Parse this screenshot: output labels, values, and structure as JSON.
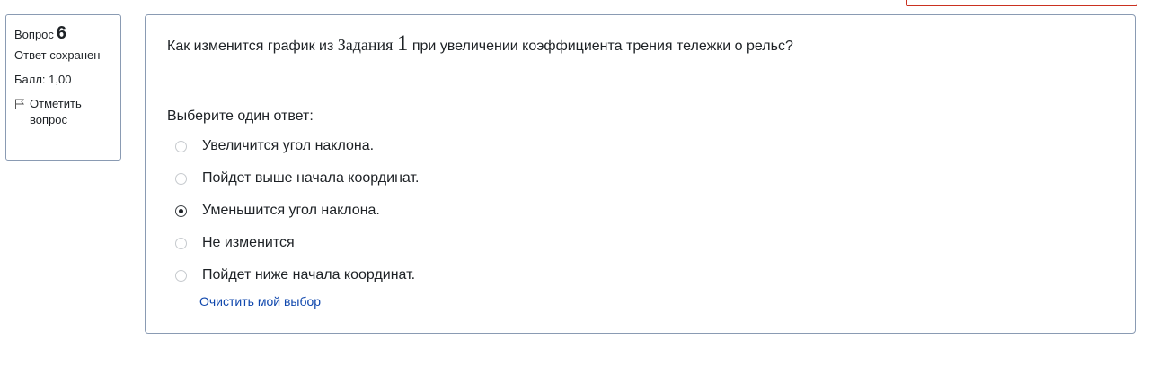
{
  "question_info": {
    "label": "Вопрос",
    "number": "6",
    "state": "Ответ сохранен",
    "grade": "Балл: 1,00",
    "flag_label": "Отметить вопрос"
  },
  "question": {
    "text_before": "Как изменится график из ",
    "text_serif": "Задания",
    "text_number": "1",
    "text_after": " при увеличении коэффициента трения тележки о рельс?",
    "prompt": "Выберите один ответ:",
    "answers": [
      {
        "label": "Увеличится угол наклона.",
        "selected": false
      },
      {
        "label": "Пойдет выше начала координат.",
        "selected": false
      },
      {
        "label": "Уменьшится угол наклона.",
        "selected": true
      },
      {
        "label": "Не изменится",
        "selected": false
      },
      {
        "label": "Пойдет ниже начала координат.",
        "selected": false
      }
    ],
    "clear_label": "Очистить мой выбор"
  },
  "colors": {
    "border": "#8a9bb3",
    "link": "#0f47ad",
    "alert_border": "#ca3120"
  }
}
